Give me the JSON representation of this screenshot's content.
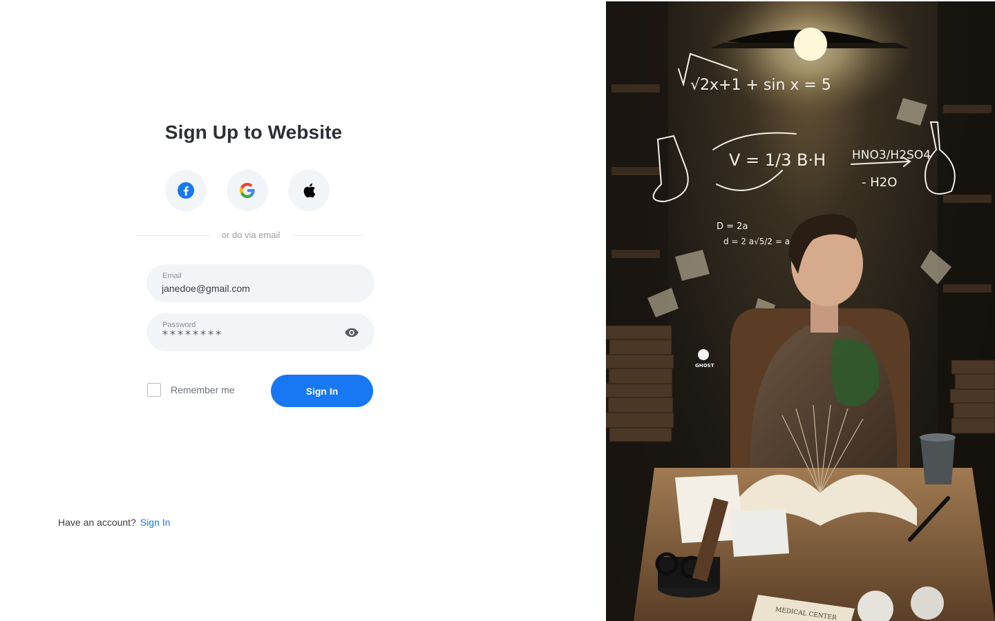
{
  "form": {
    "title": "Sign Up to Website",
    "social": [
      {
        "name": "facebook",
        "icon": "facebook-icon",
        "color": "#1877f2"
      },
      {
        "name": "google",
        "icon": "google-icon"
      },
      {
        "name": "apple",
        "icon": "apple-icon",
        "color": "#000000"
      }
    ],
    "divider_text": "or do via email",
    "email": {
      "label": "Email",
      "value": "janedoe@gmail.com"
    },
    "password": {
      "label": "Password",
      "masked_value": "********",
      "toggle_icon": "eye-icon"
    },
    "remember_label": "Remember me",
    "remember_checked": false,
    "submit_label": "Sign In"
  },
  "footer": {
    "prompt": "Have an account?",
    "link": "Sign In"
  },
  "illustration": {
    "equations": [
      "√2x+1 + sin x = 5",
      "V = 1/3 B·H",
      "HNO3/H2SO4",
      "- H2O",
      "D = 2a",
      "d = 2 a√5/2 = a√5"
    ],
    "badge": "GHOST",
    "book_title": "MEDICAL CENTER"
  },
  "colors": {
    "accent": "#1877f2",
    "field_bg": "#f2f5f8",
    "title": "#2c2f36"
  }
}
